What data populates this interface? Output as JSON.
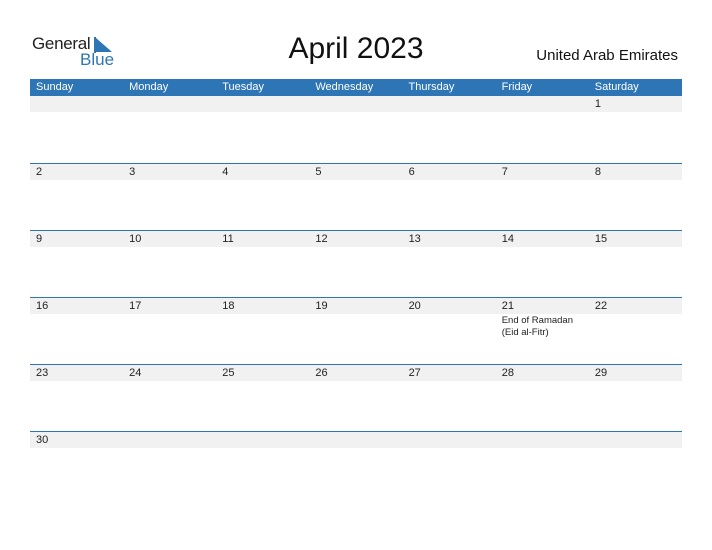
{
  "logo": {
    "text_general": "General",
    "text_blue": "Blue"
  },
  "title": "April 2023",
  "country": "United Arab Emirates",
  "colors": {
    "accent": "#2e75b6",
    "strip": "#f1f1f1"
  },
  "weekdays": [
    "Sunday",
    "Monday",
    "Tuesday",
    "Wednesday",
    "Thursday",
    "Friday",
    "Saturday"
  ],
  "weeks": [
    [
      "",
      "",
      "",
      "",
      "",
      "",
      "1"
    ],
    [
      "2",
      "3",
      "4",
      "5",
      "6",
      "7",
      "8"
    ],
    [
      "9",
      "10",
      "11",
      "12",
      "13",
      "14",
      "15"
    ],
    [
      "16",
      "17",
      "18",
      "19",
      "20",
      "21",
      "22"
    ],
    [
      "23",
      "24",
      "25",
      "26",
      "27",
      "28",
      "29"
    ],
    [
      "30",
      "",
      "",
      "",
      "",
      "",
      ""
    ]
  ],
  "events": [
    {
      "week": 3,
      "day": 5,
      "lines": [
        "End of Ramadan",
        "(Eid al-Fitr)"
      ]
    }
  ]
}
